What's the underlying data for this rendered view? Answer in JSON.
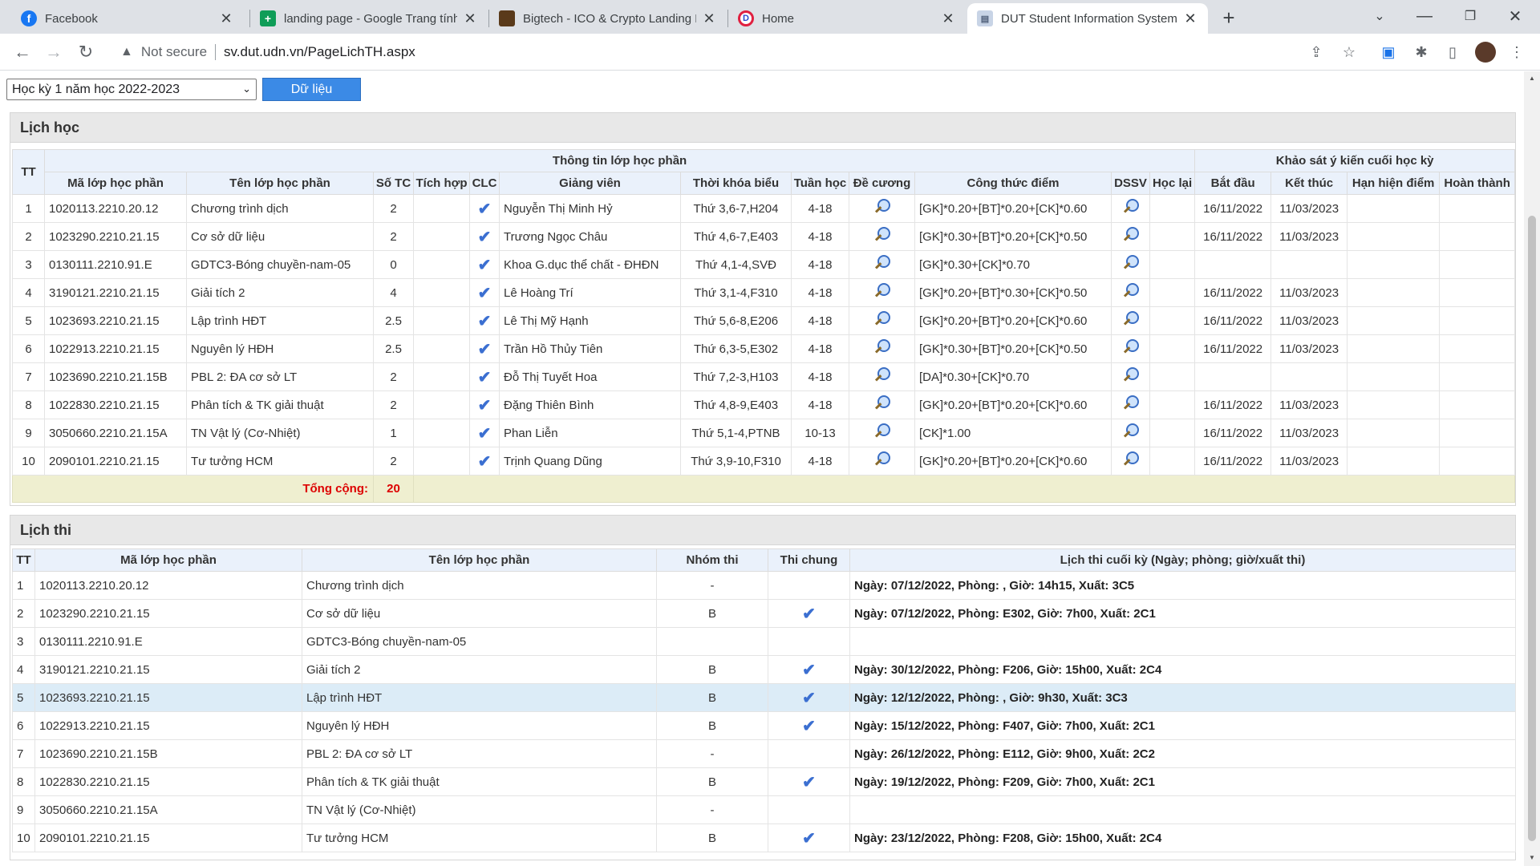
{
  "browser": {
    "tabs": [
      {
        "title": "Facebook",
        "icon": "facebook-icon"
      },
      {
        "title": "landing page - Google Trang tính",
        "icon": "sheets-icon"
      },
      {
        "title": "Bigtech - ICO & Crypto Landing P",
        "icon": "bigtech-icon"
      },
      {
        "title": "Home",
        "icon": "home-site-icon"
      },
      {
        "title": "DUT Student Information System",
        "icon": "dut-icon"
      }
    ],
    "not_secure": "Not secure",
    "url": "sv.dut.udn.vn/PageLichTH.aspx"
  },
  "controls": {
    "semester": "Học kỳ 1 năm học 2022-2023",
    "data_button": "Dữ liệu"
  },
  "schedule": {
    "title": "Lịch học",
    "group_info": "Thông tin lớp học phần",
    "group_survey": "Khảo sát ý kiến cuối học kỳ",
    "headers": [
      "TT",
      "Mã lớp học phần",
      "Tên lớp học phần",
      "Số TC",
      "Tích hợp",
      "CLC",
      "Giảng viên",
      "Thời khóa biểu",
      "Tuần học",
      "Đề cương",
      "Công thức điểm",
      "DSSV",
      "Học lại",
      "Bắt đầu",
      "Kết thúc",
      "Hạn hiện điểm",
      "Hoàn thành"
    ],
    "rows": [
      {
        "tt": "1",
        "code": "1020113.2210.20.12",
        "name": "Chương trình dịch",
        "tc": "2",
        "teacher": "Nguyễn Thị Minh Hỷ",
        "tkb": "Thứ 3,6-7,H204",
        "weeks": "4-18",
        "formula": "[GK]*0.20+[BT]*0.20+[CK]*0.60",
        "start": "16/11/2022",
        "end": "11/03/2023"
      },
      {
        "tt": "2",
        "code": "1023290.2210.21.15",
        "name": "Cơ sở dữ liệu",
        "tc": "2",
        "teacher": "Trương Ngọc Châu",
        "tkb": "Thứ 4,6-7,E403",
        "weeks": "4-18",
        "formula": "[GK]*0.30+[BT]*0.20+[CK]*0.50",
        "start": "16/11/2022",
        "end": "11/03/2023"
      },
      {
        "tt": "3",
        "code": "0130111.2210.91.E",
        "name": "GDTC3-Bóng chuyền-nam-05",
        "tc": "0",
        "teacher": "Khoa G.dục thể chất - ĐHĐN",
        "tkb": "Thứ 4,1-4,SVĐ",
        "weeks": "4-18",
        "formula": "[GK]*0.30+[CK]*0.70",
        "start": "",
        "end": ""
      },
      {
        "tt": "4",
        "code": "3190121.2210.21.15",
        "name": "Giải tích 2",
        "tc": "4",
        "teacher": "Lê Hoàng Trí",
        "tkb": "Thứ 3,1-4,F310",
        "weeks": "4-18",
        "formula": "[GK]*0.20+[BT]*0.30+[CK]*0.50",
        "start": "16/11/2022",
        "end": "11/03/2023"
      },
      {
        "tt": "5",
        "code": "1023693.2210.21.15",
        "name": "Lập trình HĐT",
        "tc": "2.5",
        "teacher": "Lê Thị Mỹ Hạnh",
        "tkb": "Thứ 5,6-8,E206",
        "weeks": "4-18",
        "formula": "[GK]*0.20+[BT]*0.20+[CK]*0.60",
        "start": "16/11/2022",
        "end": "11/03/2023"
      },
      {
        "tt": "6",
        "code": "1022913.2210.21.15",
        "name": "Nguyên lý HĐH",
        "tc": "2.5",
        "teacher": "Trần Hồ Thủy Tiên",
        "tkb": "Thứ 6,3-5,E302",
        "weeks": "4-18",
        "formula": "[GK]*0.30+[BT]*0.20+[CK]*0.50",
        "start": "16/11/2022",
        "end": "11/03/2023"
      },
      {
        "tt": "7",
        "code": "1023690.2210.21.15B",
        "name": "PBL 2: ĐA cơ sở LT",
        "tc": "2",
        "teacher": "Đỗ Thị Tuyết Hoa",
        "tkb": "Thứ 7,2-3,H103",
        "weeks": "4-18",
        "formula": "[DA]*0.30+[CK]*0.70",
        "start": "",
        "end": ""
      },
      {
        "tt": "8",
        "code": "1022830.2210.21.15",
        "name": "Phân tích & TK giải thuật",
        "tc": "2",
        "teacher": "Đặng Thiên Bình",
        "tkb": "Thứ 4,8-9,E403",
        "weeks": "4-18",
        "formula": "[GK]*0.20+[BT]*0.20+[CK]*0.60",
        "start": "16/11/2022",
        "end": "11/03/2023"
      },
      {
        "tt": "9",
        "code": "3050660.2210.21.15A",
        "name": "TN Vật lý (Cơ-Nhiệt)",
        "tc": "1",
        "teacher": "Phan Liễn",
        "tkb": "Thứ 5,1-4,PTNB",
        "weeks": "10-13",
        "formula": "[CK]*1.00",
        "start": "16/11/2022",
        "end": "11/03/2023"
      },
      {
        "tt": "10",
        "code": "2090101.2210.21.15",
        "name": "Tư tưởng HCM",
        "tc": "2",
        "teacher": "Trịnh Quang Dũng",
        "tkb": "Thứ 3,9-10,F310",
        "weeks": "4-18",
        "formula": "[GK]*0.20+[BT]*0.20+[CK]*0.60",
        "start": "16/11/2022",
        "end": "11/03/2023"
      }
    ],
    "total_label": "Tổng cộng:",
    "total_value": "20"
  },
  "exams": {
    "title": "Lịch thi",
    "headers": [
      "TT",
      "Mã lớp học phần",
      "Tên lớp học phần",
      "Nhóm thi",
      "Thi chung",
      "Lịch thi cuối kỳ (Ngày; phòng; giờ/xuất thi)"
    ],
    "rows": [
      {
        "tt": "1",
        "code": "1020113.2210.20.12",
        "name": "Chương trình dịch",
        "group": "-",
        "common": false,
        "schedule": "Ngày: 07/12/2022, Phòng: , Giờ: 14h15, Xuất: 3C5"
      },
      {
        "tt": "2",
        "code": "1023290.2210.21.15",
        "name": "Cơ sở dữ liệu",
        "group": "B",
        "common": true,
        "schedule": "Ngày: 07/12/2022, Phòng: E302, Giờ: 7h00, Xuất: 2C1"
      },
      {
        "tt": "3",
        "code": "0130111.2210.91.E",
        "name": "GDTC3-Bóng chuyền-nam-05",
        "group": "",
        "common": false,
        "schedule": ""
      },
      {
        "tt": "4",
        "code": "3190121.2210.21.15",
        "name": "Giải tích 2",
        "group": "B",
        "common": true,
        "schedule": "Ngày: 30/12/2022, Phòng: F206, Giờ: 15h00, Xuất: 2C4"
      },
      {
        "tt": "5",
        "code": "1023693.2210.21.15",
        "name": "Lập trình HĐT",
        "group": "B",
        "common": true,
        "schedule": "Ngày: 12/12/2022, Phòng: , Giờ: 9h30, Xuất: 3C3",
        "highlight": true
      },
      {
        "tt": "6",
        "code": "1022913.2210.21.15",
        "name": "Nguyên lý HĐH",
        "group": "B",
        "common": true,
        "schedule": "Ngày: 15/12/2022, Phòng: F407, Giờ: 7h00, Xuất: 2C1"
      },
      {
        "tt": "7",
        "code": "1023690.2210.21.15B",
        "name": "PBL 2: ĐA cơ sở LT",
        "group": "-",
        "common": false,
        "schedule": "Ngày: 26/12/2022, Phòng: E112, Giờ: 9h00, Xuất: 2C2"
      },
      {
        "tt": "8",
        "code": "1022830.2210.21.15",
        "name": "Phân tích & TK giải thuật",
        "group": "B",
        "common": true,
        "schedule": "Ngày: 19/12/2022, Phòng: F209, Giờ: 7h00, Xuất: 2C1"
      },
      {
        "tt": "9",
        "code": "3050660.2210.21.15A",
        "name": "TN Vật lý (Cơ-Nhiệt)",
        "group": "-",
        "common": false,
        "schedule": ""
      },
      {
        "tt": "10",
        "code": "2090101.2210.21.15",
        "name": "Tư tưởng HCM",
        "group": "B",
        "common": true,
        "schedule": "Ngày: 23/12/2022, Phòng: F208, Giờ: 15h00, Xuất: 2C4"
      }
    ]
  },
  "colors": {
    "accent_button": "#3b8ae6",
    "header_bg": "#eaf1fb",
    "total_bg": "#efefd0",
    "total_text": "#dd0000",
    "highlight_row": "#dcecf7",
    "check": "#3b6fd1"
  }
}
